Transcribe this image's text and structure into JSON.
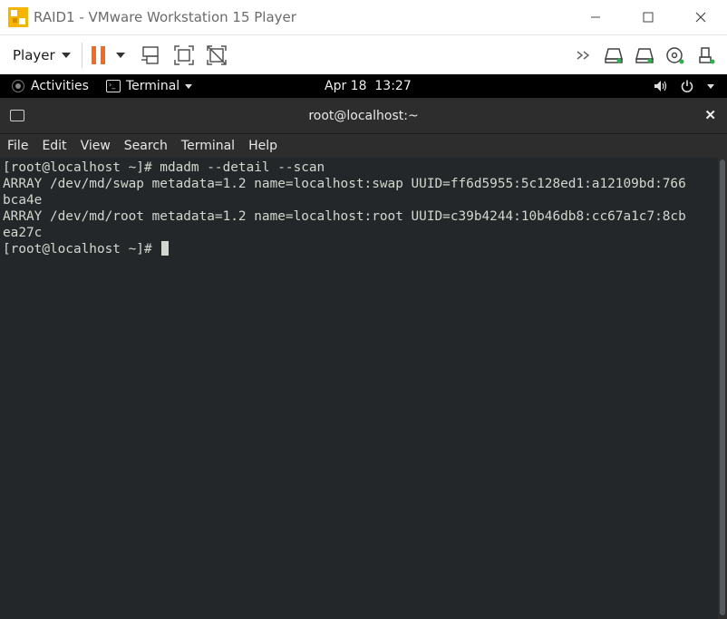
{
  "vmware": {
    "window_title": "RAID1 - VMware Workstation 15 Player",
    "player_menu_label": "Player",
    "window_controls": {
      "minimize": "—",
      "maximize": "☐",
      "close": "✕"
    }
  },
  "gnome_bar": {
    "activities": "Activities",
    "app_menu": "Terminal",
    "clock": "Apr 18  13:27"
  },
  "terminal": {
    "title": "root@localhost:~",
    "close_label": "✕",
    "menu": [
      "File",
      "Edit",
      "View",
      "Search",
      "Terminal",
      "Help"
    ],
    "lines": [
      "[root@localhost ~]# mdadm --detail --scan",
      "ARRAY /dev/md/swap metadata=1.2 name=localhost:swap UUID=ff6d5955:5c128ed1:a12109bd:766",
      "bca4e",
      "ARRAY /dev/md/root metadata=1.2 name=localhost:root UUID=c39b4244:10b46db8:cc67a1c7:8cb",
      "ea27c"
    ],
    "prompt": "[root@localhost ~]# "
  },
  "colors": {
    "pause_accent": "#f26b21",
    "terminal_bg": "#232729",
    "terminal_fg": "#d3d7cf",
    "header_bg": "#2d2d2d"
  },
  "icons": {
    "vm_logo": "vmware-logo-icon",
    "pause": "pause-icon",
    "send_ctrl_alt_del": "send-keys-icon",
    "full_screen": "fullscreen-icon",
    "unity": "unity-icon",
    "devices": [
      "chevrons-icon",
      "hdd-icon",
      "hdd-icon",
      "cd-icon",
      "usb-icon"
    ]
  }
}
